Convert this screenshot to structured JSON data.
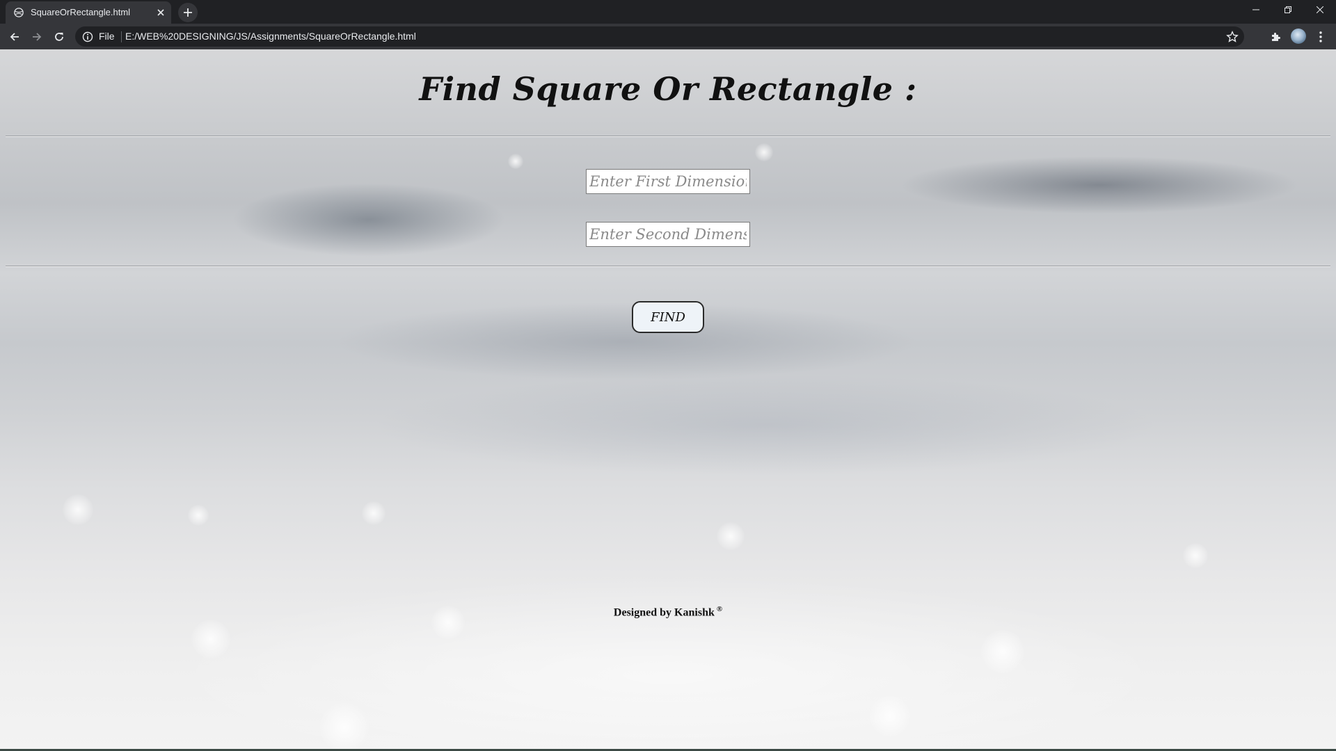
{
  "browser": {
    "tab_title": "SquareOrRectangle.html",
    "url_scheme": "File",
    "url": "E:/WEB%20DESIGNING/JS/Assignments/SquareOrRectangle.html"
  },
  "page": {
    "title": "Find Square Or Rectangle :",
    "first_input_placeholder": "Enter First Dimension",
    "second_input_placeholder": "Enter Second Dimension",
    "find_button_label": "FIND",
    "footer_text": "Designed by Kanishk",
    "footer_mark": "®"
  },
  "colors": {
    "tab_bar": "#202124",
    "toolbar": "#35363a",
    "omnibox": "#202124",
    "button_bg": "#eef3f8"
  }
}
